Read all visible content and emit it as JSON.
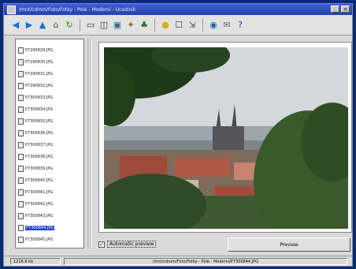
{
  "window": {
    "title": "/mnt/cdrom/Foto/Fotky - Pole - Moderni - Ucastnik"
  },
  "toolbar": {
    "icons": [
      "back-arrow-icon",
      "forward-arrow-icon",
      "up-arrow-icon",
      "home-icon",
      "refresh-icon",
      "view-window-icon",
      "view-split-icon",
      "image-icon",
      "folder-tools-icon",
      "tree-icon",
      "lightbulb-icon",
      "frame-icon",
      "export-icon",
      "globe-icon",
      "mail-icon",
      "help-icon"
    ]
  },
  "files": [
    {
      "label": "P7290829.JPG",
      "selected": false
    },
    {
      "label": "P7290830.JPG",
      "selected": false
    },
    {
      "label": "P7290831.JPG",
      "selected": false
    },
    {
      "label": "P7290832.JPG",
      "selected": false
    },
    {
      "label": "P7300833.JPG",
      "selected": false
    },
    {
      "label": "P7300834.JPG",
      "selected": false
    },
    {
      "label": "P7300835.JPG",
      "selected": false
    },
    {
      "label": "P7300836.JPG",
      "selected": false
    },
    {
      "label": "P7300837.JPG",
      "selected": false
    },
    {
      "label": "P7300838.JPG",
      "selected": false
    },
    {
      "label": "P7300839.JPG",
      "selected": false
    },
    {
      "label": "P7300840.JPG",
      "selected": false
    },
    {
      "label": "P7300841.JPG",
      "selected": false
    },
    {
      "label": "P7300842.JPG",
      "selected": false
    },
    {
      "label": "P7300843.JPG",
      "selected": false
    },
    {
      "label": "P7300844.JPG",
      "selected": true
    },
    {
      "label": "P7300845.JPG",
      "selected": false
    }
  ],
  "preview": {
    "automatic_label": "Automatic preview",
    "automatic_checked": true,
    "button_label": "Preview"
  },
  "status": {
    "size": "1216.6 kb",
    "path": "/mnt/cdrom/Foto/Fotky - Pole - Moderni/P7300844.JPG"
  },
  "colors": {
    "selection": "#1a46c8",
    "desktop": "#0a2a7a"
  }
}
